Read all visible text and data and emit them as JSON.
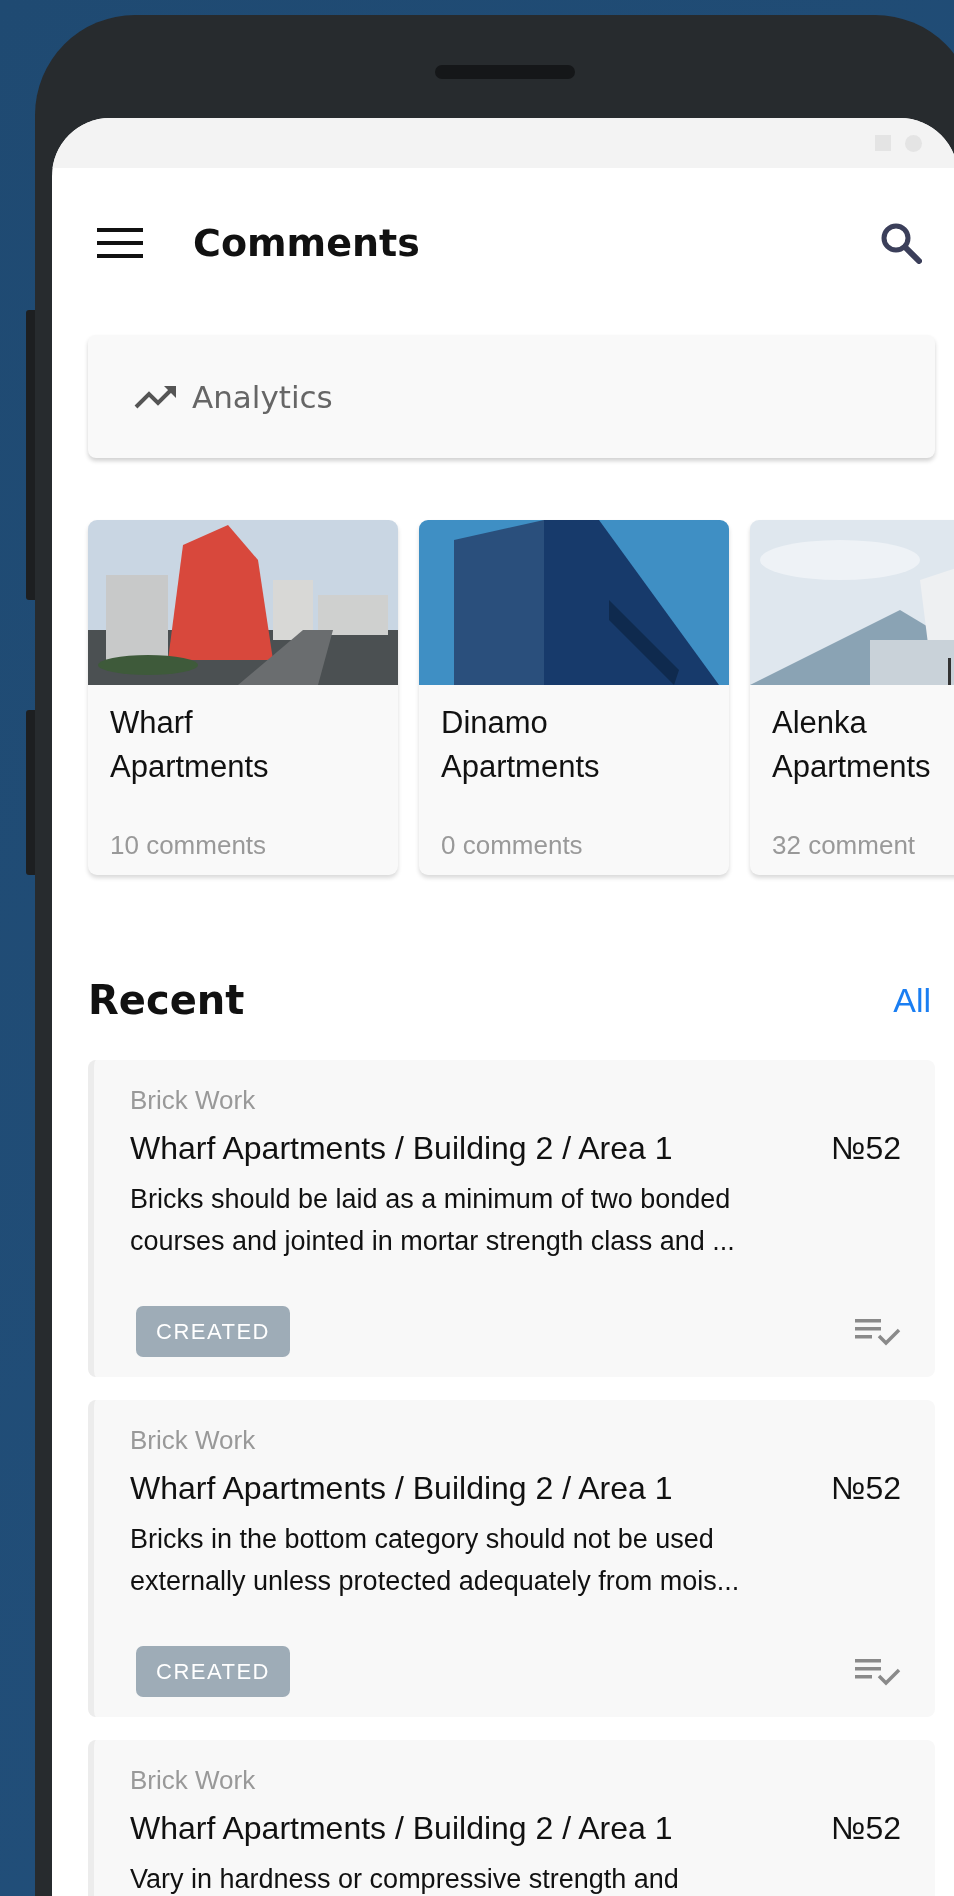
{
  "app_bar": {
    "title": "Comments"
  },
  "analytics": {
    "label": "Analytics"
  },
  "projects": [
    {
      "name": "Wharf Apartments",
      "comments": "10 comments"
    },
    {
      "name": "Dinamo Apartments",
      "comments": "0 comments"
    },
    {
      "name": "Alenka Apartments",
      "comments": "32 comment"
    }
  ],
  "recent": {
    "title": "Recent",
    "all_link": "All"
  },
  "comments": [
    {
      "category": "Brick Work",
      "location": "Wharf Apartments / Building 2 / Area 1",
      "number": "№52",
      "text": "Bricks should be laid as a minimum of two bonded courses and jointed in mortar strength class and ...",
      "status": "CREATED"
    },
    {
      "category": "Brick Work",
      "location": "Wharf Apartments / Building 2 / Area 1",
      "number": "№52",
      "text": "Bricks in the bottom category should not be used externally unless protected adequately from mois...",
      "status": "CREATED"
    },
    {
      "category": "Brick Work",
      "location": "Wharf Apartments / Building 2 / Area 1",
      "number": "№52",
      "text": "Vary in hardness or compressive strength and"
    }
  ]
}
